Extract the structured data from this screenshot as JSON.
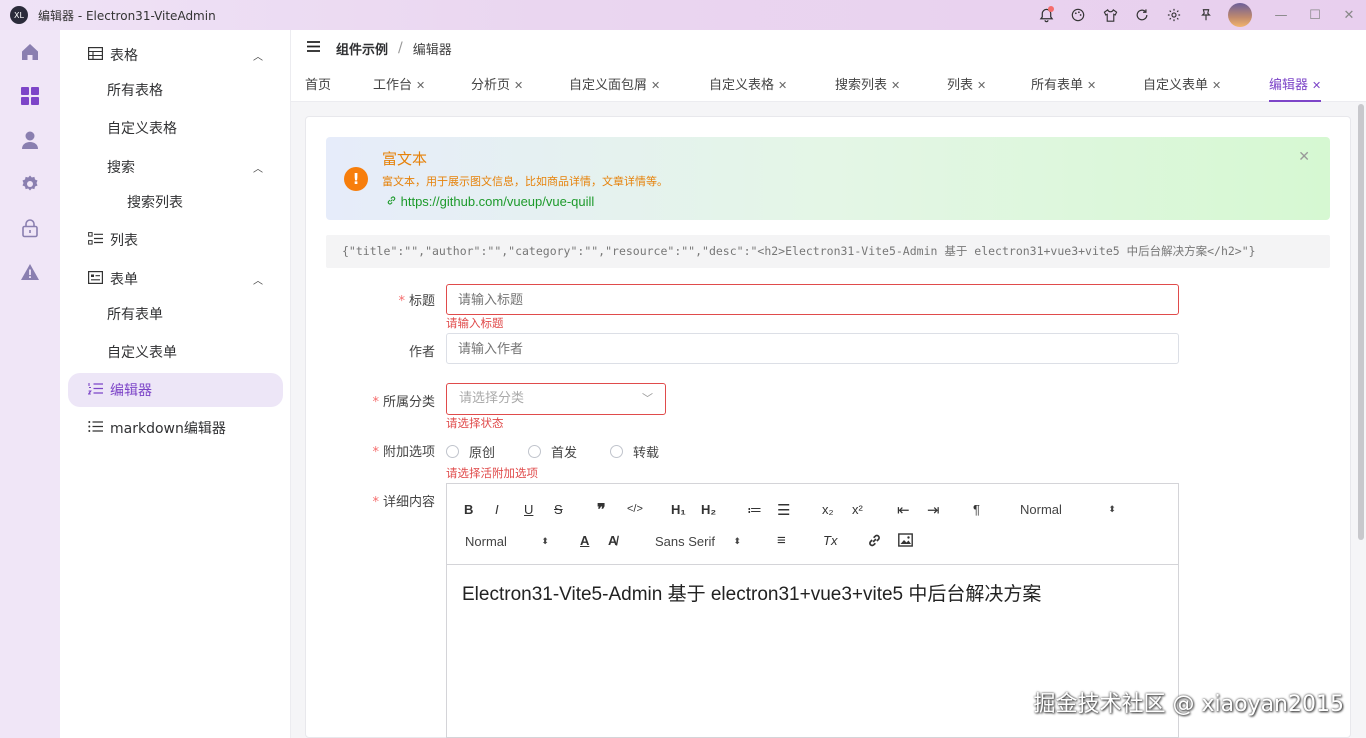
{
  "window": {
    "title": "编辑器 - Electron31-ViteAdmin",
    "logo_text": "XL",
    "icons": [
      "bell-icon",
      "palette-icon",
      "shirt-icon",
      "refresh-icon",
      "gear-icon",
      "pin-icon"
    ]
  },
  "rail": {
    "icons": [
      "home-icon",
      "grid-icon",
      "user-icon",
      "settings-icon",
      "lock-icon",
      "warning-icon"
    ]
  },
  "sidebar": {
    "items": [
      {
        "label": "表格",
        "icon": "table-icon",
        "expanded": true
      },
      {
        "label": "所有表格"
      },
      {
        "label": "自定义表格"
      },
      {
        "label": "搜索",
        "expanded": true
      },
      {
        "label": "搜索列表"
      },
      {
        "label": "列表",
        "icon": "list-icon"
      },
      {
        "label": "表单",
        "icon": "form-icon",
        "expanded": true
      },
      {
        "label": "所有表单"
      },
      {
        "label": "自定义表单"
      },
      {
        "label": "编辑器",
        "icon": "list-ordered-icon",
        "active": true
      },
      {
        "label": "markdown编辑器",
        "icon": "list-icon"
      }
    ]
  },
  "breadcrumb": {
    "parent": "组件示例",
    "sep": "/",
    "current": "编辑器"
  },
  "tabs": [
    {
      "label": "首页"
    },
    {
      "label": "工作台",
      "closable": true
    },
    {
      "label": "分析页",
      "closable": true
    },
    {
      "label": "自定义面包屑",
      "closable": true
    },
    {
      "label": "自定义表格",
      "closable": true
    },
    {
      "label": "搜索列表",
      "closable": true
    },
    {
      "label": "列表",
      "closable": true
    },
    {
      "label": "所有表单",
      "closable": true
    },
    {
      "label": "自定义表单",
      "closable": true
    },
    {
      "label": "编辑器",
      "closable": true,
      "active": true
    }
  ],
  "alert": {
    "icon": "!",
    "title": "富文本",
    "desc": "富文本，用于展示图文信息，比如商品详情，文章详情等。",
    "link": "https://github.com/vueup/vue-quill",
    "close": "✕"
  },
  "json_preview": "{\"title\":\"\",\"author\":\"\",\"category\":\"\",\"resource\":\"\",\"desc\":\"<h2>Electron31-Vite5-Admin 基于 electron31+vue3+vite5 中后台解决方案</h2>\"}",
  "form": {
    "title": {
      "label": "标题",
      "required": true,
      "placeholder": "请输入标题",
      "error": "请输入标题"
    },
    "author": {
      "label": "作者",
      "placeholder": "请输入作者"
    },
    "category": {
      "label": "所属分类",
      "required": true,
      "placeholder": "请选择分类",
      "error": "请选择状态"
    },
    "extra": {
      "label": "附加选项",
      "required": true,
      "options": [
        "原创",
        "首发",
        "转载"
      ],
      "error": "请选择活附加选项"
    },
    "content": {
      "label": "详细内容",
      "required": true
    }
  },
  "editor": {
    "toolbar_row1": [
      "B",
      "I",
      "U",
      "S",
      "❞",
      "</>",
      "H₁",
      "H₂",
      "≔",
      "☰",
      "x₂",
      "x²",
      "⇤",
      "⇥",
      "¶"
    ],
    "size_select": "Normal",
    "header_select": "Normal",
    "font_select": "Sans Serif",
    "toolbar_row2_icons": [
      "A",
      "A̸",
      "≡",
      "Tx",
      "🔗",
      "▣"
    ],
    "content": "Electron31-Vite5-Admin 基于 electron31+vue3+vite5 中后台解决方案"
  },
  "watermark": "掘金技术社区 @ xiaoyan2015"
}
